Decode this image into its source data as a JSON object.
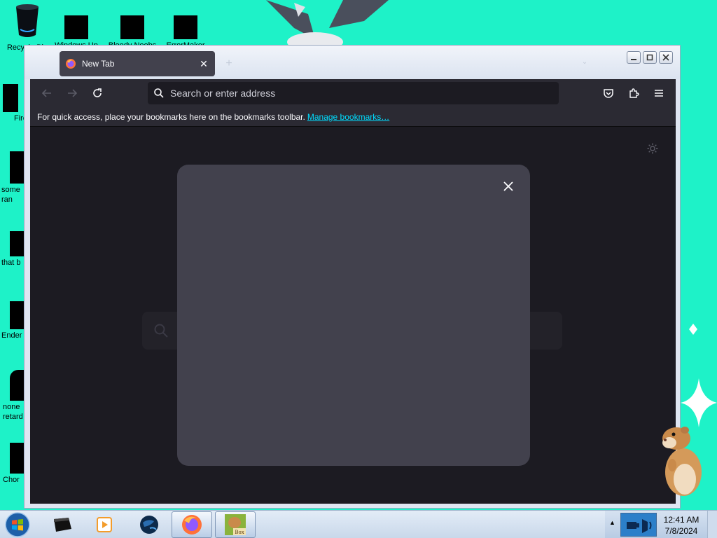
{
  "desktop": {
    "icons_top": [
      {
        "label": "Recycle Bin"
      },
      {
        "label": "Windows Up"
      },
      {
        "label": "Bloody Noobs"
      },
      {
        "label": "ErrorMaker"
      }
    ],
    "icons_left": [
      {
        "label": "Fire"
      },
      {
        "label": "some ran"
      },
      {
        "label": "that b"
      },
      {
        "label": "Ender"
      },
      {
        "label": "none retard"
      },
      {
        "label": "Chor"
      }
    ]
  },
  "browser": {
    "tab": {
      "title": "New Tab",
      "favicon": "firefox-icon"
    },
    "urlbar": {
      "placeholder": "Search or enter address"
    },
    "bookmarks_bar": {
      "hint": "For quick access, place your bookmarks here on the bookmarks toolbar.",
      "link": "Manage bookmarks…"
    }
  },
  "taskbar": {
    "items": [
      {
        "name": "app-icon-black"
      },
      {
        "name": "media-player-icon"
      },
      {
        "name": "globe-icon"
      },
      {
        "name": "firefox-icon",
        "active": true
      },
      {
        "name": "box-game-icon",
        "active": true,
        "label": "Box"
      }
    ],
    "clock": {
      "time": "12:41 AM",
      "date": "7/8/2024"
    }
  },
  "colors": {
    "desktop_bg": "#1ef2c8",
    "toolbar": "#2b2a33",
    "content_bg": "#1c1b22",
    "modal_bg": "#42414d",
    "link": "#00ddff"
  }
}
